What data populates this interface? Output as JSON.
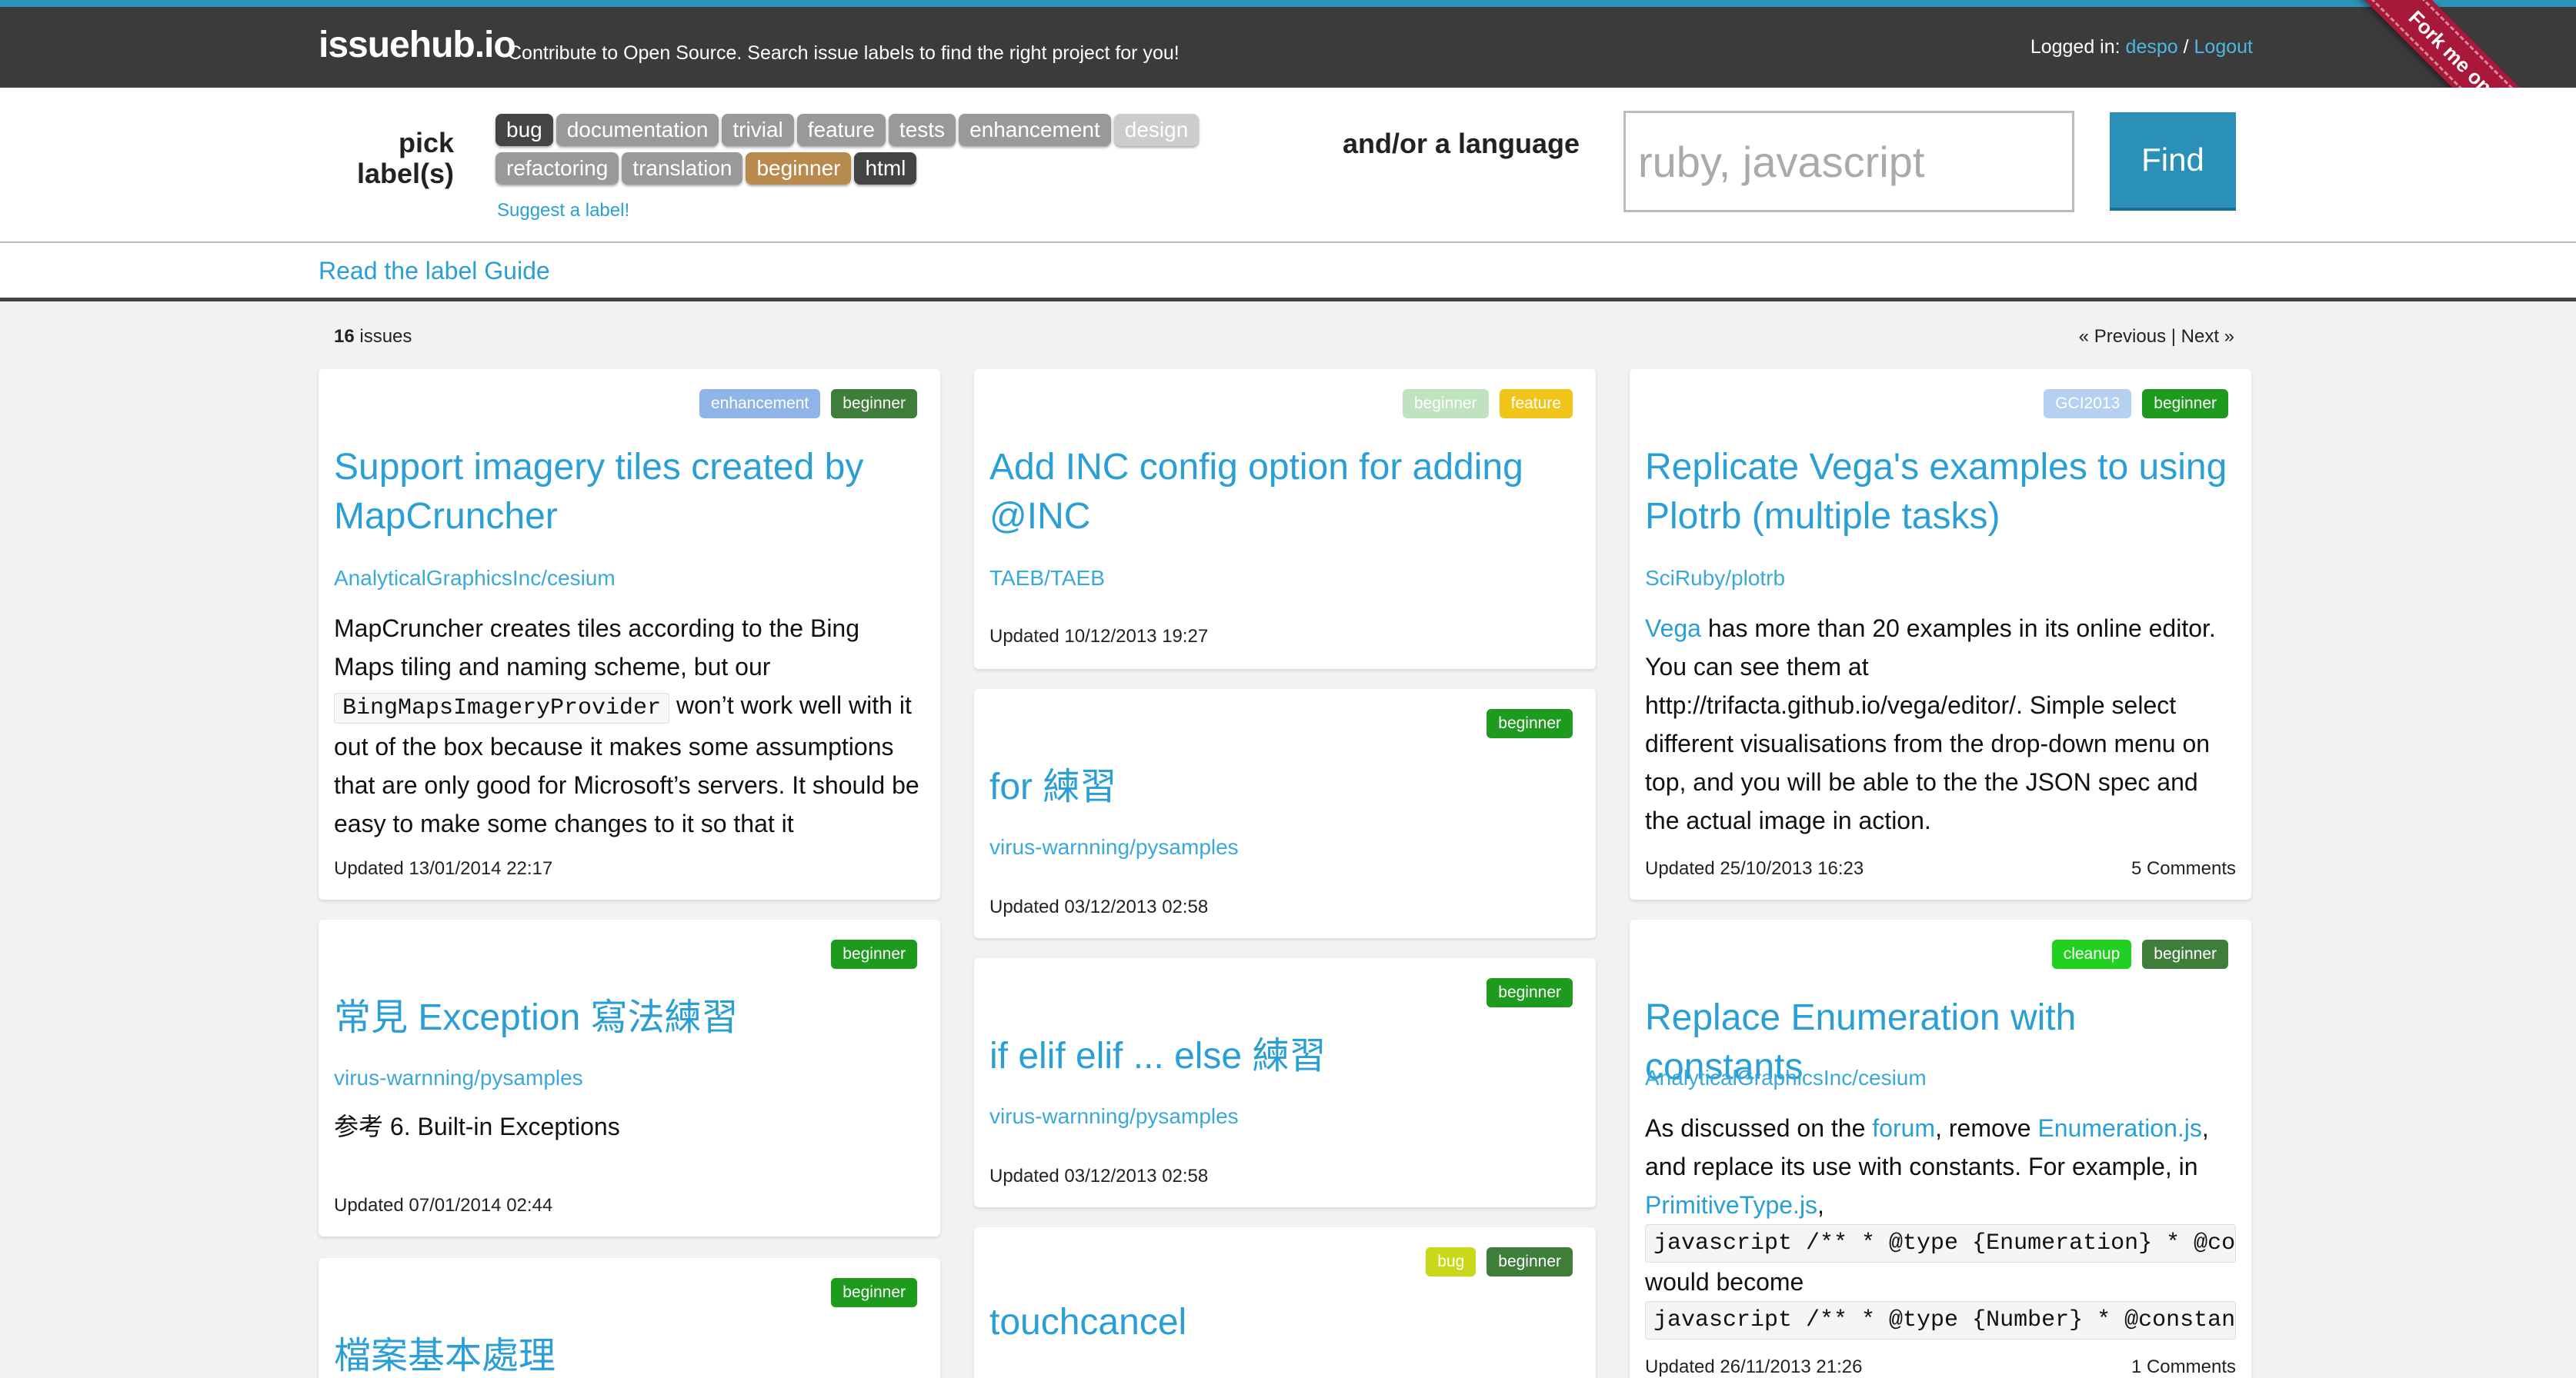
{
  "header": {
    "logo": "issuehub.io",
    "tagline": "Contribute to Open Source. Search issue labels to find the right project for you!",
    "login_prefix": "Logged in:",
    "user": "despo",
    "separator": "/",
    "logout": "Logout",
    "ribbon": "Fork me on GitHub"
  },
  "filter": {
    "pick_line1": "pick",
    "pick_line2": "label(s)",
    "labels": [
      "bug",
      "documentation",
      "trivial",
      "feature",
      "tests",
      "enhancement",
      "design",
      "refactoring",
      "translation",
      "beginner",
      "html"
    ],
    "suggest": "Suggest a label!",
    "language_label": "and/or a language",
    "language_placeholder": "ruby, javascript",
    "find": "Find"
  },
  "guide_link": "Read the label Guide",
  "results": {
    "count": "16",
    "count_suffix": "issues",
    "pager": "« Previous | Next »"
  },
  "colors": {
    "accent": "#2a9fd6",
    "topbar": "#3b3b3b",
    "find_button": "#2a90b8",
    "ribbon": "#a8183a"
  },
  "cards": {
    "c1": {
      "tags": [
        "enhancement",
        "beginner"
      ],
      "title": "Support imagery tiles created by MapCruncher",
      "repo": "AnalyticalGraphicsInc/cesium",
      "body_a": "MapCruncher creates tiles according to the Bing Maps tiling and naming scheme, but our ",
      "body_code": "BingMapsImageryProvider",
      "body_b": " won’t work well with it out of the box because it makes some assumptions that are only good for Microsoft’s servers. It should be easy to make some changes to it so that it",
      "updated": "Updated 13/01/2014 22:17"
    },
    "c2": {
      "tags": [
        "beginner"
      ],
      "title": "常見 Exception 寫法練習",
      "repo": "virus-warnning/pysamples",
      "body": "参考 6. Built-in Exceptions",
      "updated": "Updated 07/01/2014 02:44"
    },
    "c3": {
      "tags": [
        "beginner"
      ],
      "title": "檔案基本處理"
    },
    "c4": {
      "tags": [
        "beginner",
        "feature"
      ],
      "title": "Add INC config option for adding @INC",
      "repo": "TAEB/TAEB",
      "updated": "Updated 10/12/2013 19:27"
    },
    "c5": {
      "tags": [
        "beginner"
      ],
      "title": "for 練習",
      "repo": "virus-warnning/pysamples",
      "updated": "Updated 03/12/2013 02:58"
    },
    "c6": {
      "tags": [
        "beginner"
      ],
      "title": "if elif elif ... else 練習",
      "repo": "virus-warnning/pysamples",
      "updated": "Updated 03/12/2013 02:58"
    },
    "c7": {
      "tags": [
        "bug",
        "beginner"
      ],
      "title": "touchcancel"
    },
    "c8": {
      "tags": [
        "GCI2013",
        "beginner"
      ],
      "title": "Replicate Vega's examples to using Plotrb (multiple tasks)",
      "repo": "SciRuby/plotrb",
      "body_link": "Vega",
      "body": " has more than 20 examples in its online editor. You can see them at http://trifacta.github.io/vega/editor/. Simple select different visualisations from the drop-down menu on top, and you will be able to the the JSON spec and the actual image in action.",
      "updated": "Updated 25/10/2013 16:23",
      "comments": "5 Comments"
    },
    "c9": {
      "tags": [
        "cleanup",
        "beginner"
      ],
      "title": "Replace Enumeration with constants",
      "repo": "AnalyticalGraphicsInc/cesium",
      "b1": "As discussed on the ",
      "l1": "forum",
      "b2": ", remove ",
      "l2": "Enumeration.js",
      "b3": ", and replace its use with constants. For example, in ",
      "l3": "PrimitiveType.js",
      "b4": ",",
      "code1": "javascript /** * @type {Enumeration} * @constant */",
      "b5": "would become",
      "code2": "javascript /** * @type {Number} * @constant */",
      "updated": "Updated 26/11/2013 21:26",
      "comments": "1 Comments"
    }
  }
}
